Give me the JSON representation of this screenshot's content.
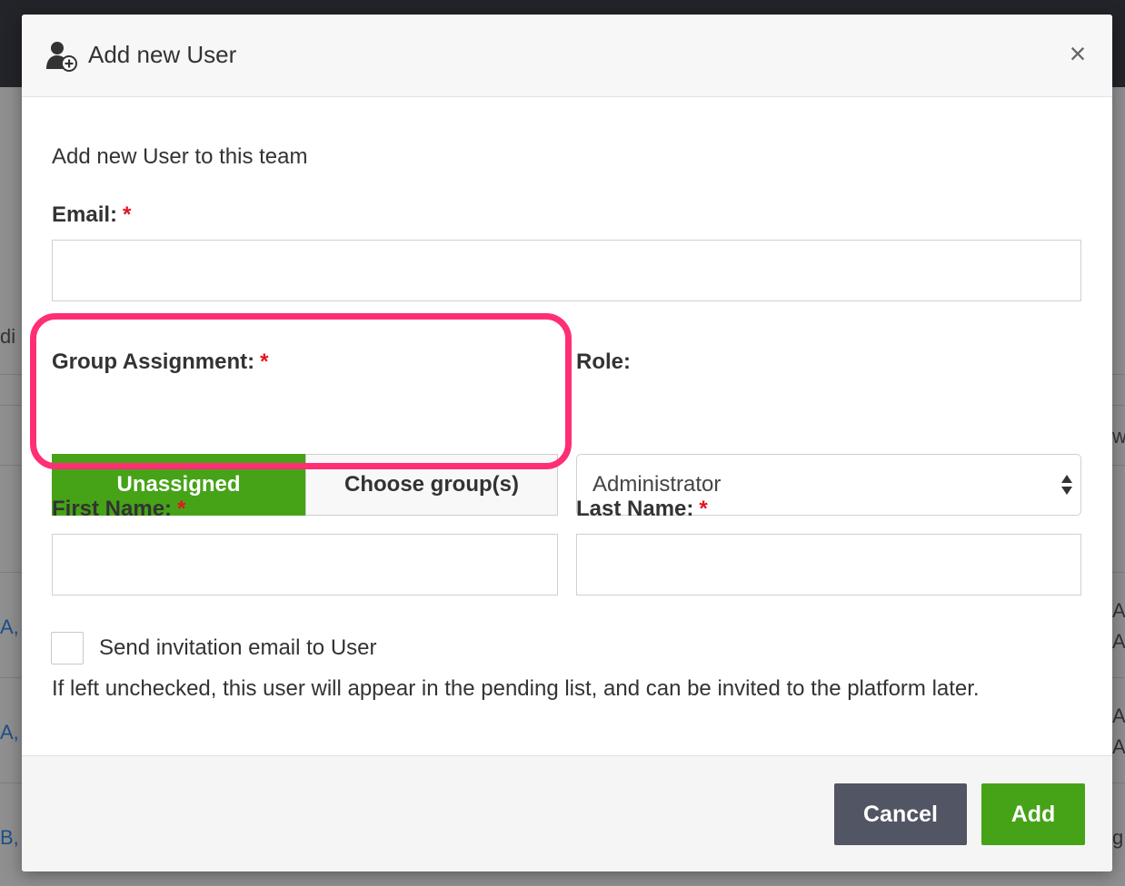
{
  "modal": {
    "title": "Add new User",
    "intro": "Add new User to this team"
  },
  "form": {
    "email_label": "Email:",
    "group_label": "Group Assignment:",
    "group_options": [
      "Unassigned",
      "Choose group(s)"
    ],
    "group_selected": "Unassigned",
    "role_label": "Role:",
    "role_value": "Administrator",
    "first_name_label": "First Name:",
    "last_name_label": "Last Name:",
    "required_mark": "*",
    "invite_label": "Send invitation email to User",
    "invite_checked": false,
    "invite_hint": "If left unchecked, this user will appear in the pending list, and can be invited to the platform later."
  },
  "footer": {
    "cancel_label": "Cancel",
    "add_label": "Add"
  },
  "background": {
    "fragments": [
      "di",
      "A,",
      "A,",
      "B,",
      "A,",
      "A",
      "A,",
      "A",
      "g",
      "w"
    ]
  },
  "colors": {
    "primary": "#46a317",
    "cancel": "#525563",
    "required": "#e3141e",
    "highlight": "#ff2f73"
  }
}
